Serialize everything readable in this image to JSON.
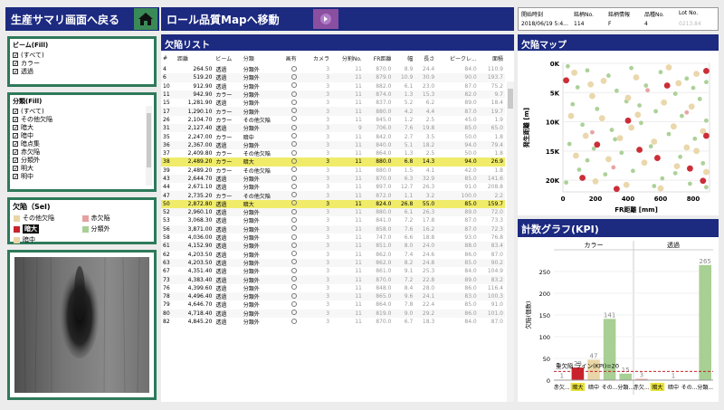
{
  "header": {
    "back_button_label": "生産サマリ画面へ戻る",
    "map_button_label": "ロール品質Mapへ移動",
    "info_labels": [
      "開始時刻",
      "銘柄No.",
      "銘柄情報",
      "品種No.",
      "Lot No."
    ],
    "info_values": [
      "2018/06/19 5:4...",
      "114",
      "F",
      "4",
      "0213.84"
    ]
  },
  "filters": {
    "beam_title": "ビーム(Fill)",
    "beam_items": [
      "(すべて)",
      "カラー",
      "透過"
    ],
    "class_title": "分類(Fill)",
    "class_items": [
      "(すべて)",
      "その他欠陥",
      "暗大",
      "暗中",
      "暗点集",
      "赤欠陥",
      "分類外",
      "明大",
      "明中"
    ],
    "defect_title": "欠陥（Sel)",
    "defect_legend": [
      {
        "label": "その他欠陥",
        "color": "#e9d5a6"
      },
      {
        "label": "赤欠陥",
        "color": "#e6a0a0"
      },
      {
        "label": "暗大",
        "color": "#c8232c"
      },
      {
        "label": "分類外",
        "color": "#a8cf94"
      },
      {
        "label": "暗中",
        "color": "#e9d5a6"
      }
    ]
  },
  "defect_list": {
    "title": "欠陥リスト",
    "columns": [
      "#",
      "距離",
      "ビーム",
      "分類",
      "画有",
      "カメラ",
      "分割No.",
      "FR距離",
      "幅",
      "長さ",
      "ピークレ...",
      "面積"
    ],
    "rows": [
      [
        "4",
        "264.50",
        "透過",
        "分類外",
        "",
        "3",
        "11",
        "870.0",
        "8.9",
        "24.4",
        "84.0",
        "110.9"
      ],
      [
        "6",
        "519.20",
        "透過",
        "分類外",
        "",
        "3",
        "11",
        "879.0",
        "10.9",
        "30.9",
        "90.0",
        "193.7"
      ],
      [
        "10",
        "912.90",
        "透過",
        "分類外",
        "",
        "3",
        "11",
        "882.0",
        "6.1",
        "23.0",
        "87.0",
        "75.2"
      ],
      [
        "11",
        "942.90",
        "カラー",
        "分類外",
        "",
        "3",
        "11",
        "874.0",
        "1.3",
        "15.3",
        "82.0",
        "9.7"
      ],
      [
        "15",
        "1,281.90",
        "透過",
        "分類外",
        "",
        "3",
        "11",
        "837.0",
        "5.2",
        "6.2",
        "89.0",
        "18.4"
      ],
      [
        "17",
        "1,290.10",
        "カラー",
        "分類外",
        "",
        "3",
        "11",
        "880.0",
        "4.2",
        "4.4",
        "87.0",
        "19.7"
      ],
      [
        "26",
        "2,104.70",
        "カラー",
        "その他欠陥",
        "",
        "3",
        "11",
        "845.0",
        "1.2",
        "2.5",
        "45.0",
        "1.9"
      ],
      [
        "31",
        "2,127.40",
        "透過",
        "分類外",
        "",
        "3",
        "9",
        "706.0",
        "7.6",
        "19.8",
        "85.0",
        "65.0"
      ],
      [
        "35",
        "2,247.00",
        "カラー",
        "暗中",
        "",
        "3",
        "11",
        "842.0",
        "2.7",
        "3.5",
        "50.0",
        "1.8"
      ],
      [
        "36",
        "2,367.00",
        "透過",
        "分類外",
        "",
        "3",
        "11",
        "840.0",
        "5.1",
        "18.2",
        "94.0",
        "79.4"
      ],
      [
        "37",
        "2,409.80",
        "カラー",
        "その他欠陥",
        "",
        "3",
        "11",
        "864.0",
        "1.3",
        "2.5",
        "50.0",
        "1.8"
      ],
      [
        "38",
        "2,489.20",
        "カラー",
        "暗大",
        "",
        "3",
        "11",
        "880.0",
        "6.8",
        "14.3",
        "94.0",
        "26.9"
      ],
      [
        "39",
        "2,489.20",
        "カラー",
        "その他欠陥",
        "",
        "3",
        "11",
        "880.0",
        "1.5",
        "4.1",
        "42.0",
        "1.8"
      ],
      [
        "43",
        "2,644.70",
        "透過",
        "分類外",
        "",
        "3",
        "11",
        "870.0",
        "6.3",
        "32.9",
        "85.0",
        "141.6"
      ],
      [
        "44",
        "2,671.10",
        "透過",
        "分類外",
        "",
        "3",
        "11",
        "897.0",
        "12.7",
        "26.3",
        "91.0",
        "208.8"
      ],
      [
        "47",
        "2,735.20",
        "カラー",
        "その他欠陥",
        "",
        "3",
        "11",
        "872.0",
        "1.1",
        "3.2",
        "100.0",
        "2.2"
      ],
      [
        "50",
        "2,872.80",
        "透過",
        "暗大",
        "",
        "3",
        "11",
        "824.0",
        "26.8",
        "55.0",
        "85.0",
        "159.7"
      ],
      [
        "52",
        "2,960.10",
        "透過",
        "分類外",
        "",
        "3",
        "11",
        "880.0",
        "6.1",
        "26.3",
        "89.0",
        "72.0"
      ],
      [
        "53",
        "3,068.30",
        "透過",
        "分類外",
        "",
        "3",
        "11",
        "841.0",
        "7.2",
        "17.8",
        "87.0",
        "73.3"
      ],
      [
        "56",
        "3,871.00",
        "透過",
        "分類外",
        "",
        "3",
        "11",
        "858.0",
        "7.6",
        "16.2",
        "87.0",
        "72.3"
      ],
      [
        "58",
        "4,036.00",
        "透過",
        "分類外",
        "",
        "3",
        "11",
        "747.0",
        "6.6",
        "18.8",
        "93.0",
        "76.8"
      ],
      [
        "61",
        "4,152.90",
        "透過",
        "分類外",
        "",
        "3",
        "11",
        "851.0",
        "8.0",
        "24.0",
        "88.0",
        "83.4"
      ],
      [
        "62",
        "4,203.50",
        "透過",
        "分類外",
        "",
        "3",
        "11",
        "862.0",
        "7.4",
        "24.6",
        "86.0",
        "87.0"
      ],
      [
        "63",
        "4,203.50",
        "透過",
        "分類外",
        "",
        "3",
        "11",
        "862.0",
        "8.2",
        "24.8",
        "85.0",
        "90.2"
      ],
      [
        "67",
        "4,351.40",
        "透過",
        "分類外",
        "",
        "3",
        "11",
        "861.0",
        "9.1",
        "25.3",
        "84.0",
        "104.9"
      ],
      [
        "73",
        "4,383.40",
        "透過",
        "分類外",
        "",
        "3",
        "11",
        "870.0",
        "7.2",
        "22.8",
        "89.0",
        "83.2"
      ],
      [
        "76",
        "4,399.60",
        "透過",
        "分類外",
        "",
        "3",
        "11",
        "848.0",
        "8.4",
        "28.0",
        "86.0",
        "116.4"
      ],
      [
        "78",
        "4,496.40",
        "透過",
        "分類外",
        "",
        "3",
        "11",
        "865.0",
        "9.6",
        "24.1",
        "83.0",
        "100.3"
      ],
      [
        "79",
        "4,646.70",
        "透過",
        "分類外",
        "",
        "3",
        "11",
        "864.0",
        "7.8",
        "22.4",
        "85.0",
        "91.0"
      ],
      [
        "80",
        "4,718.40",
        "透過",
        "分類外",
        "",
        "3",
        "11",
        "819.0",
        "9.0",
        "29.2",
        "86.0",
        "101.0"
      ],
      [
        "82",
        "4,845.20",
        "透過",
        "分類外",
        "",
        "3",
        "11",
        "870.0",
        "6.7",
        "18.3",
        "84.0",
        "87.0"
      ]
    ],
    "highlight_rows": [
      11,
      16
    ]
  },
  "map": {
    "title": "欠陥マップ",
    "ylabel": "発生距離 [m]",
    "xlabel": "FR距離 [mm]",
    "xticks": [
      "0",
      "200",
      "400",
      "600",
      "800"
    ],
    "yticks": [
      "0K",
      "5K",
      "10K",
      "15K",
      "20K"
    ]
  },
  "kpi": {
    "title": "計数グラフ(KPI)",
    "group_labels": [
      "カラー",
      "透過"
    ],
    "ylabel": "欠陥(個数)",
    "yticks": [
      "0",
      "50",
      "100",
      "150",
      "200",
      "250"
    ],
    "threshold_label": "重欠陥 ライン(KPI)=20"
  },
  "chart_data": [
    {
      "type": "bar",
      "title": "計数グラフ(KPI)",
      "ylabel": "欠陥(個数)",
      "ylim": [
        0,
        300
      ],
      "groups": [
        "カラー",
        "透過"
      ],
      "categories": [
        "赤欠...",
        "暗大",
        "暗中",
        "その...",
        "分類..."
      ],
      "series": [
        {
          "name": "カラー",
          "values": [
            1,
            29,
            47,
            141,
            15
          ]
        },
        {
          "name": "透過",
          "values": [
            3,
            0,
            1,
            0,
            265
          ]
        }
      ],
      "threshold": 20
    },
    {
      "type": "scatter",
      "title": "欠陥マップ",
      "xlabel": "FR距離 [mm]",
      "ylabel": "発生距離 [m]",
      "xlim": [
        0,
        900
      ],
      "ylim": [
        0,
        22000
      ],
      "series": [
        {
          "name": "分類外",
          "color": "#a8cf94",
          "points": [
            [
              30,
              500
            ],
            [
              150,
              1200
            ],
            [
              280,
              2100
            ],
            [
              420,
              800
            ],
            [
              600,
              1500
            ],
            [
              760,
              2600
            ],
            [
              880,
              3200
            ],
            [
              90,
              4100
            ],
            [
              330,
              4700
            ],
            [
              510,
              3800
            ],
            [
              690,
              5200
            ],
            [
              840,
              6100
            ],
            [
              60,
              7000
            ],
            [
              210,
              7800
            ],
            [
              390,
              6500
            ],
            [
              570,
              8200
            ],
            [
              730,
              9000
            ],
            [
              880,
              9800
            ],
            [
              120,
              10500
            ],
            [
              300,
              11400
            ],
            [
              480,
              10200
            ],
            [
              650,
              12100
            ],
            [
              810,
              12900
            ],
            [
              40,
              13800
            ],
            [
              190,
              14600
            ],
            [
              360,
              15300
            ],
            [
              540,
              14200
            ],
            [
              720,
              16000
            ],
            [
              860,
              17100
            ],
            [
              100,
              18200
            ],
            [
              260,
              19000
            ],
            [
              430,
              18400
            ],
            [
              610,
              19700
            ],
            [
              780,
              20600
            ],
            [
              880,
              21200
            ],
            [
              150,
              16600
            ],
            [
              470,
              7200
            ],
            [
              800,
              4200
            ],
            [
              320,
              13000
            ],
            [
              690,
              18800
            ],
            [
              560,
              21000
            ],
            [
              20,
              20400
            ]
          ]
        },
        {
          "name": "その他欠陥",
          "color": "#e9d5a6",
          "points": [
            [
              70,
              1600
            ],
            [
              250,
              3000
            ],
            [
              450,
              2400
            ],
            [
              650,
              700
            ],
            [
              820,
              1800
            ],
            [
              180,
              5600
            ],
            [
              400,
              5900
            ],
            [
              620,
              6700
            ],
            [
              790,
              7400
            ],
            [
              50,
              9000
            ],
            [
              240,
              9400
            ],
            [
              460,
              8800
            ],
            [
              680,
              10800
            ],
            [
              860,
              11600
            ],
            [
              140,
              12400
            ],
            [
              350,
              12800
            ],
            [
              560,
              13400
            ],
            [
              760,
              14400
            ],
            [
              80,
              15800
            ],
            [
              280,
              16400
            ],
            [
              500,
              17000
            ],
            [
              700,
              17600
            ],
            [
              880,
              18600
            ],
            [
              200,
              20200
            ],
            [
              390,
              20800
            ],
            [
              600,
              21400
            ],
            [
              820,
              15000
            ],
            [
              420,
              11000
            ],
            [
              170,
              3600
            ],
            [
              710,
              3400
            ]
          ]
        },
        {
          "name": "暗大",
          "color": "#c8232c",
          "points": [
            [
              880,
              1300
            ],
            [
              20,
              2900
            ],
            [
              640,
              3800
            ],
            [
              400,
              9800
            ],
            [
              880,
              12400
            ],
            [
              210,
              13900
            ],
            [
              580,
              16200
            ],
            [
              780,
              18000
            ],
            [
              120,
              19600
            ],
            [
              330,
              21500
            ],
            [
              860,
              20100
            ],
            [
              470,
              14800
            ]
          ]
        },
        {
          "name": "赤欠陥",
          "color": "#e6a0a0",
          "points": [
            [
              520,
              4600
            ],
            [
              180,
              11800
            ],
            [
              760,
              8400
            ],
            [
              310,
              17800
            ]
          ]
        }
      ]
    }
  ]
}
